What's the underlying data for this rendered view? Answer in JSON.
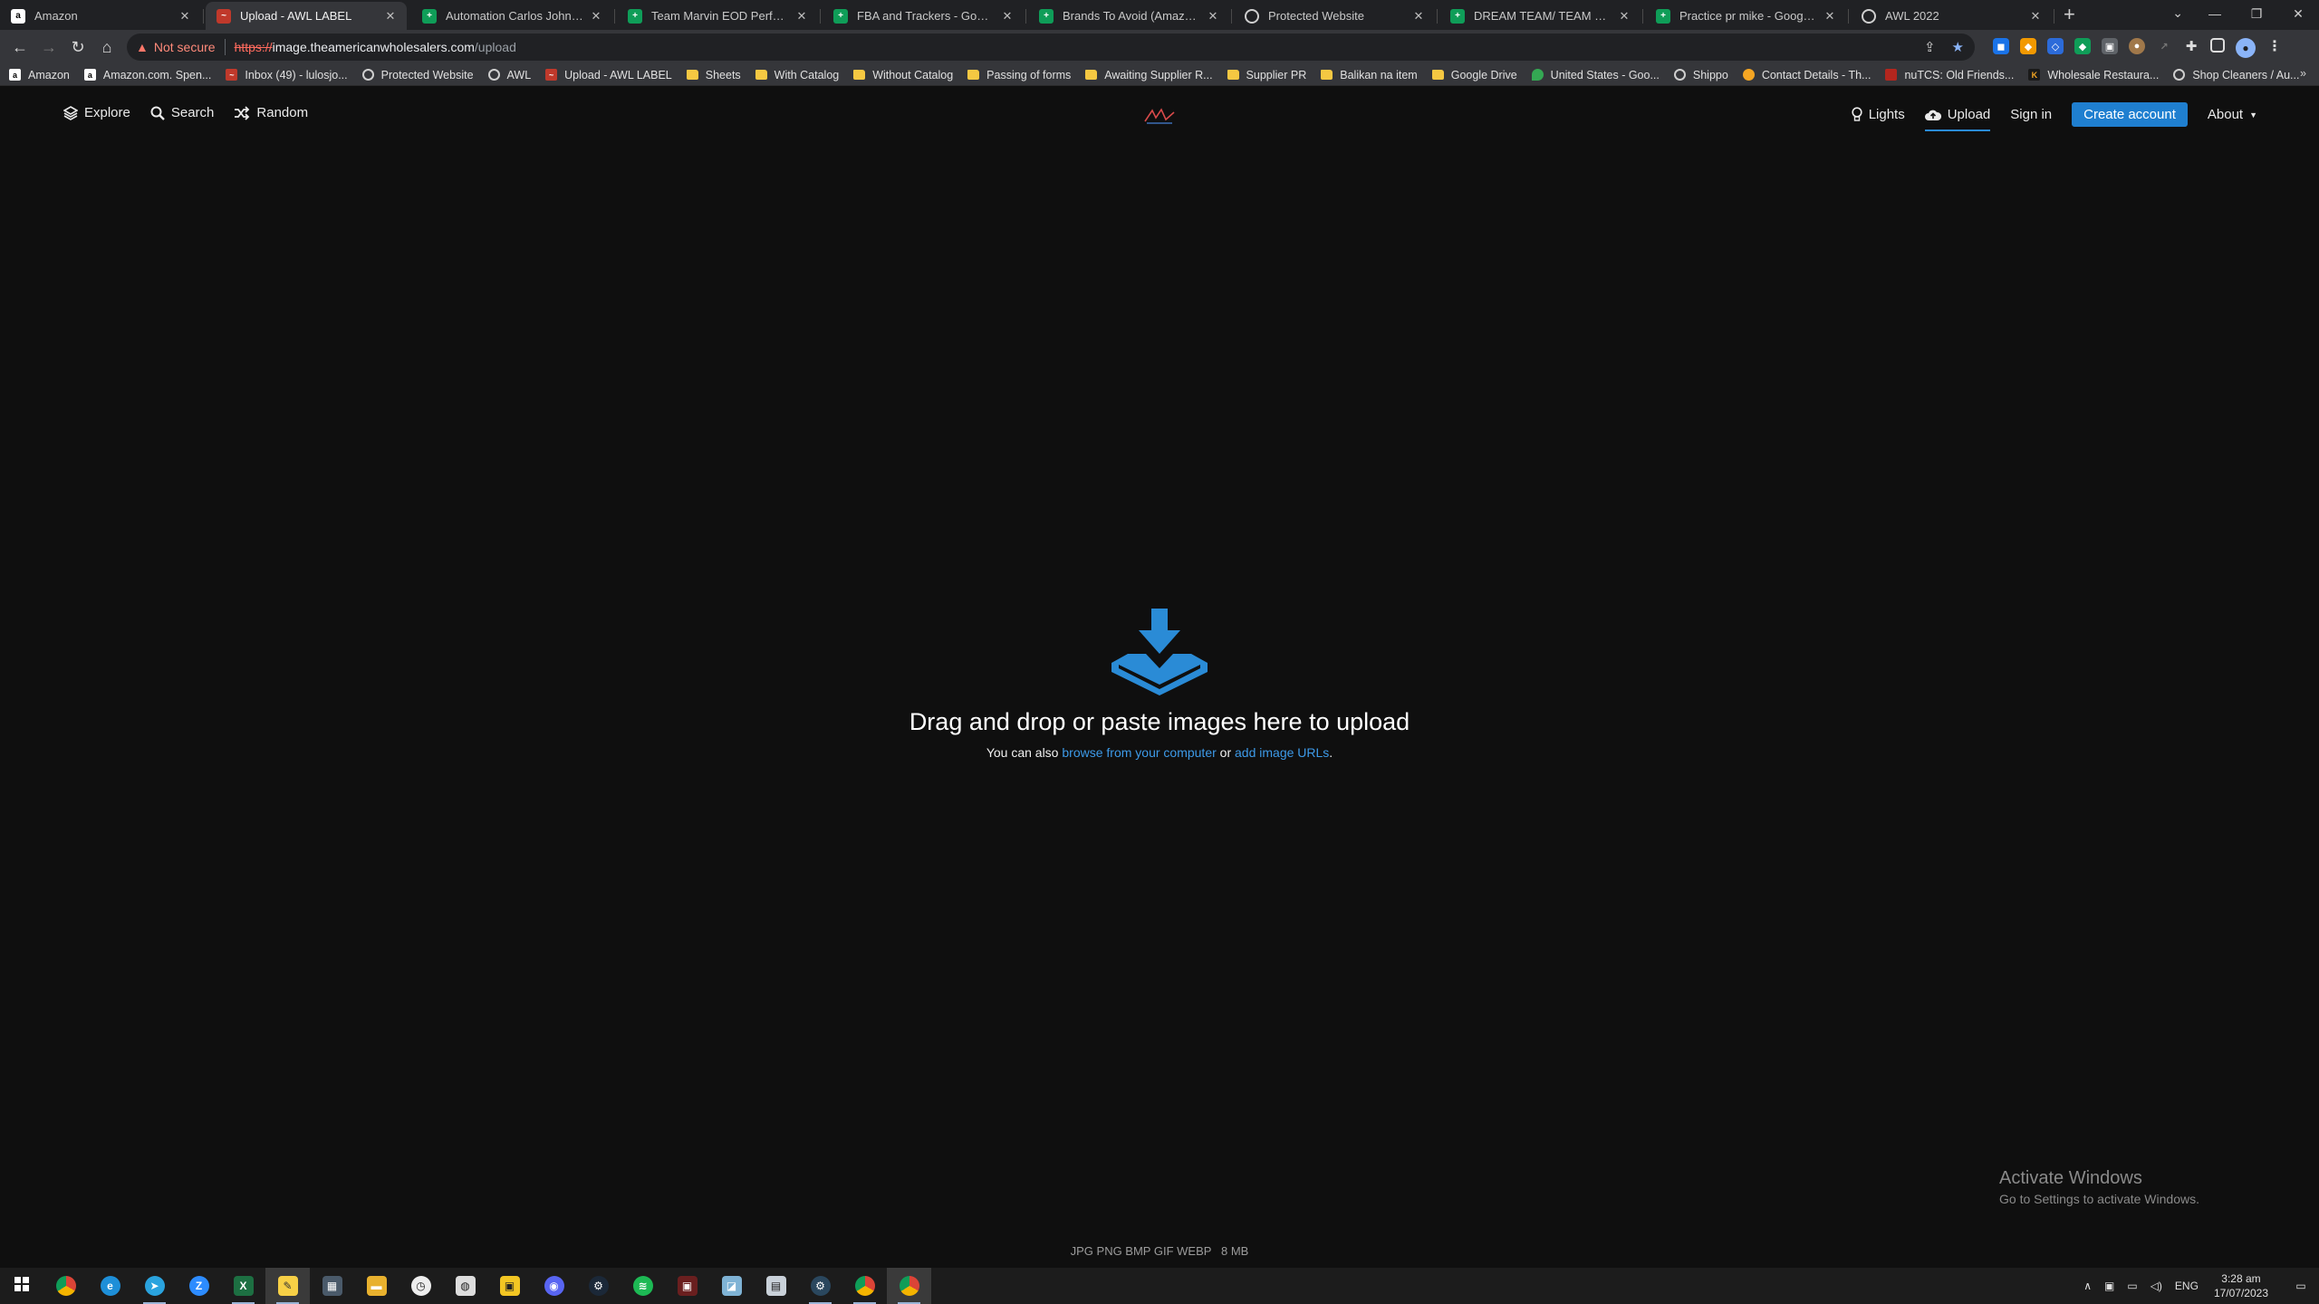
{
  "browser": {
    "tabs": [
      {
        "title": "Amazon",
        "fav": "a",
        "favclass": "fav-amazon",
        "active": false
      },
      {
        "title": "Upload - AWL LABEL",
        "fav": "~",
        "favclass": "fav-awl",
        "active": true
      },
      {
        "title": "Automation Carlos Johnson - G",
        "fav": "+",
        "favclass": "fav-sheets",
        "active": false
      },
      {
        "title": "Team Marvin EOD Performanc",
        "fav": "+",
        "favclass": "fav-sheets",
        "active": false
      },
      {
        "title": "FBA and Trackers - Google She",
        "fav": "+",
        "favclass": "fav-sheets",
        "active": false
      },
      {
        "title": "Brands To Avoid (Amazon) - Go",
        "fav": "+",
        "favclass": "fav-sheets",
        "active": false
      },
      {
        "title": "Protected Website",
        "fav": "",
        "favclass": "fav-globe",
        "active": false
      },
      {
        "title": "DREAM TEAM/ TEAM MARVIN",
        "fav": "+",
        "favclass": "fav-sheets",
        "active": false
      },
      {
        "title": "Practice pr mike - Google She",
        "fav": "+",
        "favclass": "fav-sheets",
        "active": false
      },
      {
        "title": "AWL 2022",
        "fav": "",
        "favclass": "fav-globe",
        "active": false
      }
    ],
    "new_tab": "+",
    "address": {
      "not_secure": "Not secure",
      "scheme": "https://",
      "host": "image.theamericanwholesalers.com",
      "path": "/upload"
    },
    "bookmarks": [
      {
        "label": "Amazon",
        "icon": "amazon"
      },
      {
        "label": "Amazon.com. Spen...",
        "icon": "amazon"
      },
      {
        "label": "Inbox (49) - lulosjo...",
        "icon": "awl"
      },
      {
        "label": "Protected Website",
        "icon": "globe"
      },
      {
        "label": "AWL",
        "icon": "globe"
      },
      {
        "label": "Upload - AWL LABEL",
        "icon": "awl"
      },
      {
        "label": "Sheets",
        "icon": "folder"
      },
      {
        "label": "With Catalog",
        "icon": "folder"
      },
      {
        "label": "Without Catalog",
        "icon": "folder"
      },
      {
        "label": "Passing of forms",
        "icon": "folder"
      },
      {
        "label": "Awaiting Supplier R...",
        "icon": "folder"
      },
      {
        "label": "Supplier PR",
        "icon": "folder"
      },
      {
        "label": "Balikan na item",
        "icon": "folder"
      },
      {
        "label": "Google Drive",
        "icon": "folder"
      },
      {
        "label": "United States - Goo...",
        "icon": "maps"
      },
      {
        "label": "Shippo",
        "icon": "globe"
      },
      {
        "label": "Contact Details - Th...",
        "icon": "drop"
      },
      {
        "label": "nuTCS: Old Friends...",
        "icon": "red"
      },
      {
        "label": "Wholesale Restaura...",
        "icon": "k"
      },
      {
        "label": "Shop Cleaners / Au...",
        "icon": "globe"
      }
    ],
    "bookmarks_more": "»"
  },
  "site": {
    "nav_left": [
      "Explore",
      "Search",
      "Random"
    ],
    "nav_right": {
      "lights": "Lights",
      "upload": "Upload",
      "signin": "Sign in",
      "create": "Create account",
      "about": "About"
    },
    "drop": {
      "title": "Drag and drop or paste images here to upload",
      "sub_prefix": "You can also",
      "browse": "browse from your computer",
      "or": "or",
      "urls": "add image URLs",
      "suffix": "."
    },
    "formats": "JPG PNG BMP GIF WEBP   8 MB",
    "accent": "#2a8bd6"
  },
  "os": {
    "watermark_title": "Activate Windows",
    "watermark_sub": "Go to Settings to activate Windows.",
    "lang": "ENG",
    "time": "3:28 am",
    "date": "17/07/2023"
  }
}
